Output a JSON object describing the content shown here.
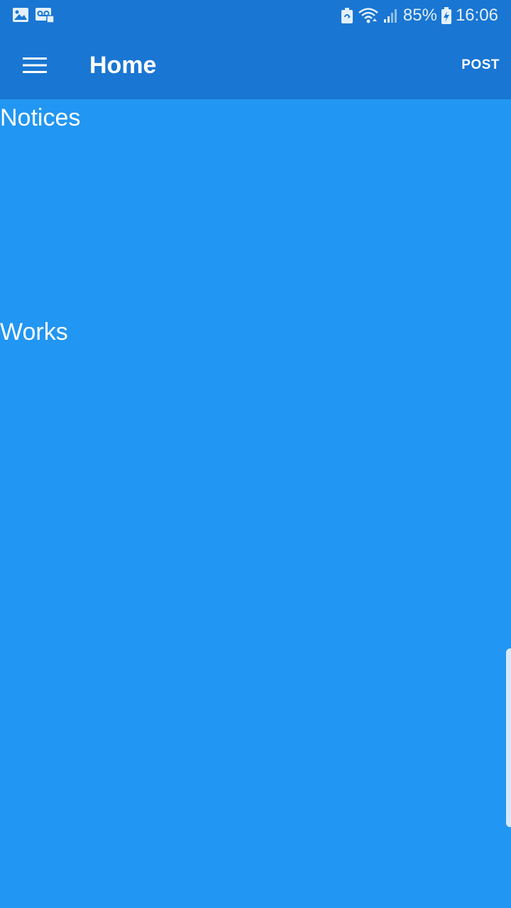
{
  "status_bar": {
    "battery_percent": "85%",
    "time": "16:06",
    "icons": [
      "image-notification-icon",
      "voicemail-icon",
      "battery-saver-icon",
      "wifi-icon",
      "signal-icon",
      "battery-charging-icon"
    ]
  },
  "app_bar": {
    "title": "Home",
    "post_label": "POST",
    "menu_icon": "hamburger-menu-icon"
  },
  "sections": {
    "notices_title": "Notices",
    "works_title": "Works"
  },
  "colors": {
    "app_bar": "#1976D2",
    "background": "#2196F3",
    "text": "#FFFFFF"
  }
}
